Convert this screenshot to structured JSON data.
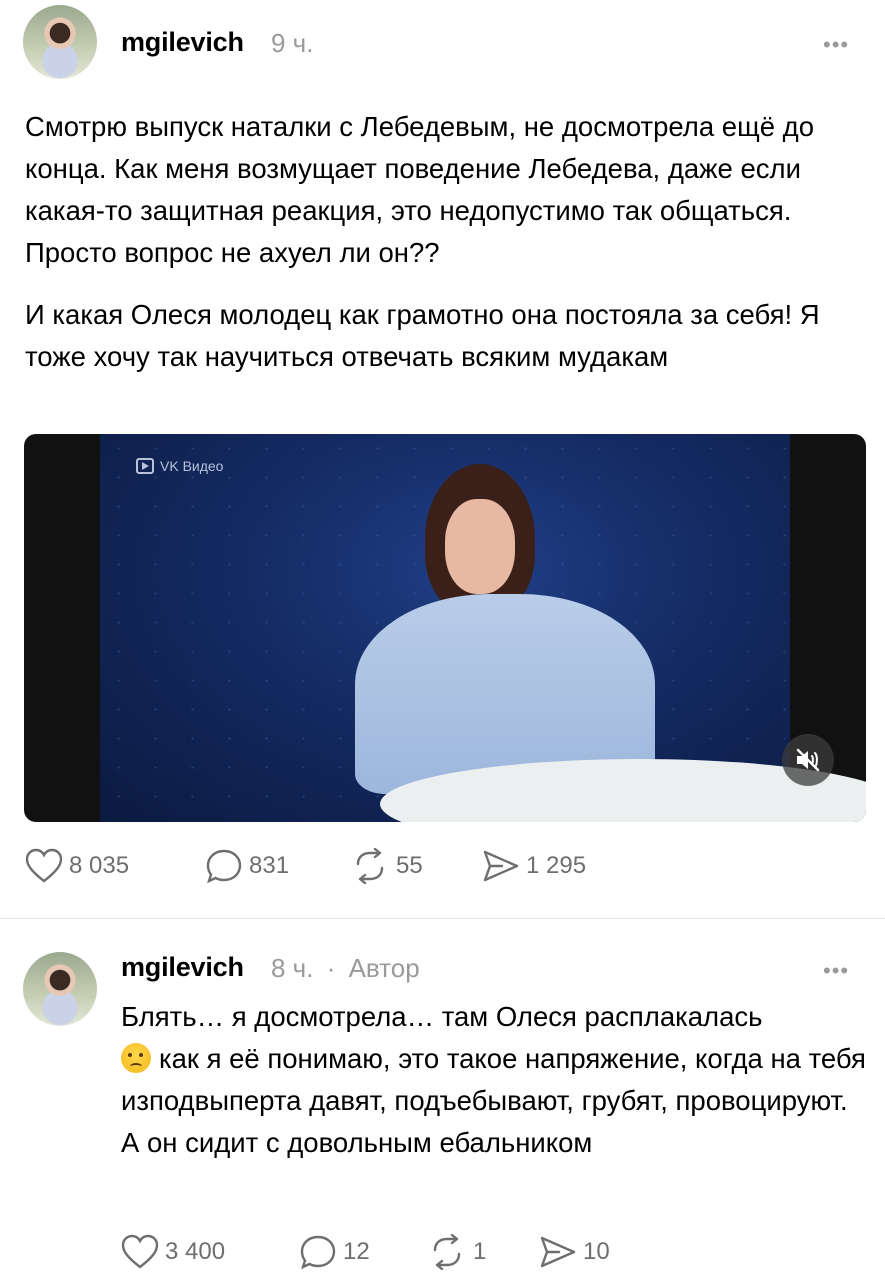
{
  "post": {
    "username": "mgilevich",
    "time": "9 ч.",
    "more": "•••",
    "paragraphs": [
      "Смотрю выпуск наталки с Лебедевым, не досмотрела ещё до конца. Как меня возмущает поведение Лебедева, даже если какая-то защитная реакция, это недопустимо так общаться. Просто вопрос не ахуел ли он??",
      "И какая Олеся молодец как грамотно она постояла за себя! Я тоже хочу так научиться отвечать всяким мудакам"
    ],
    "video": {
      "badge": "VK Видео",
      "muted": true
    },
    "actions": {
      "likes": "8 035",
      "comments": "831",
      "reposts": "55",
      "shares": "1 295"
    }
  },
  "reply": {
    "username": "mgilevich",
    "time": "8 ч.",
    "separator": "·",
    "author_tag": "Автор",
    "more": "•••",
    "text_before_emoji": "Блять… я досмотрела… там Олеся расплакалась",
    "emoji": "crying-face-emoji",
    "text_after_emoji": "как я её понимаю, это такое напряжение, когда на тебя изподвыперта давят, подъебывают, грубят, провоцируют. А он сидит с довольным ебальником",
    "actions": {
      "likes": "3 400",
      "comments": "12",
      "reposts": "1",
      "shares": "10"
    }
  },
  "colors": {
    "text": "#000000",
    "muted": "#9a9a9a",
    "icon": "#6e6e6e",
    "divider": "#e6e6e6"
  }
}
